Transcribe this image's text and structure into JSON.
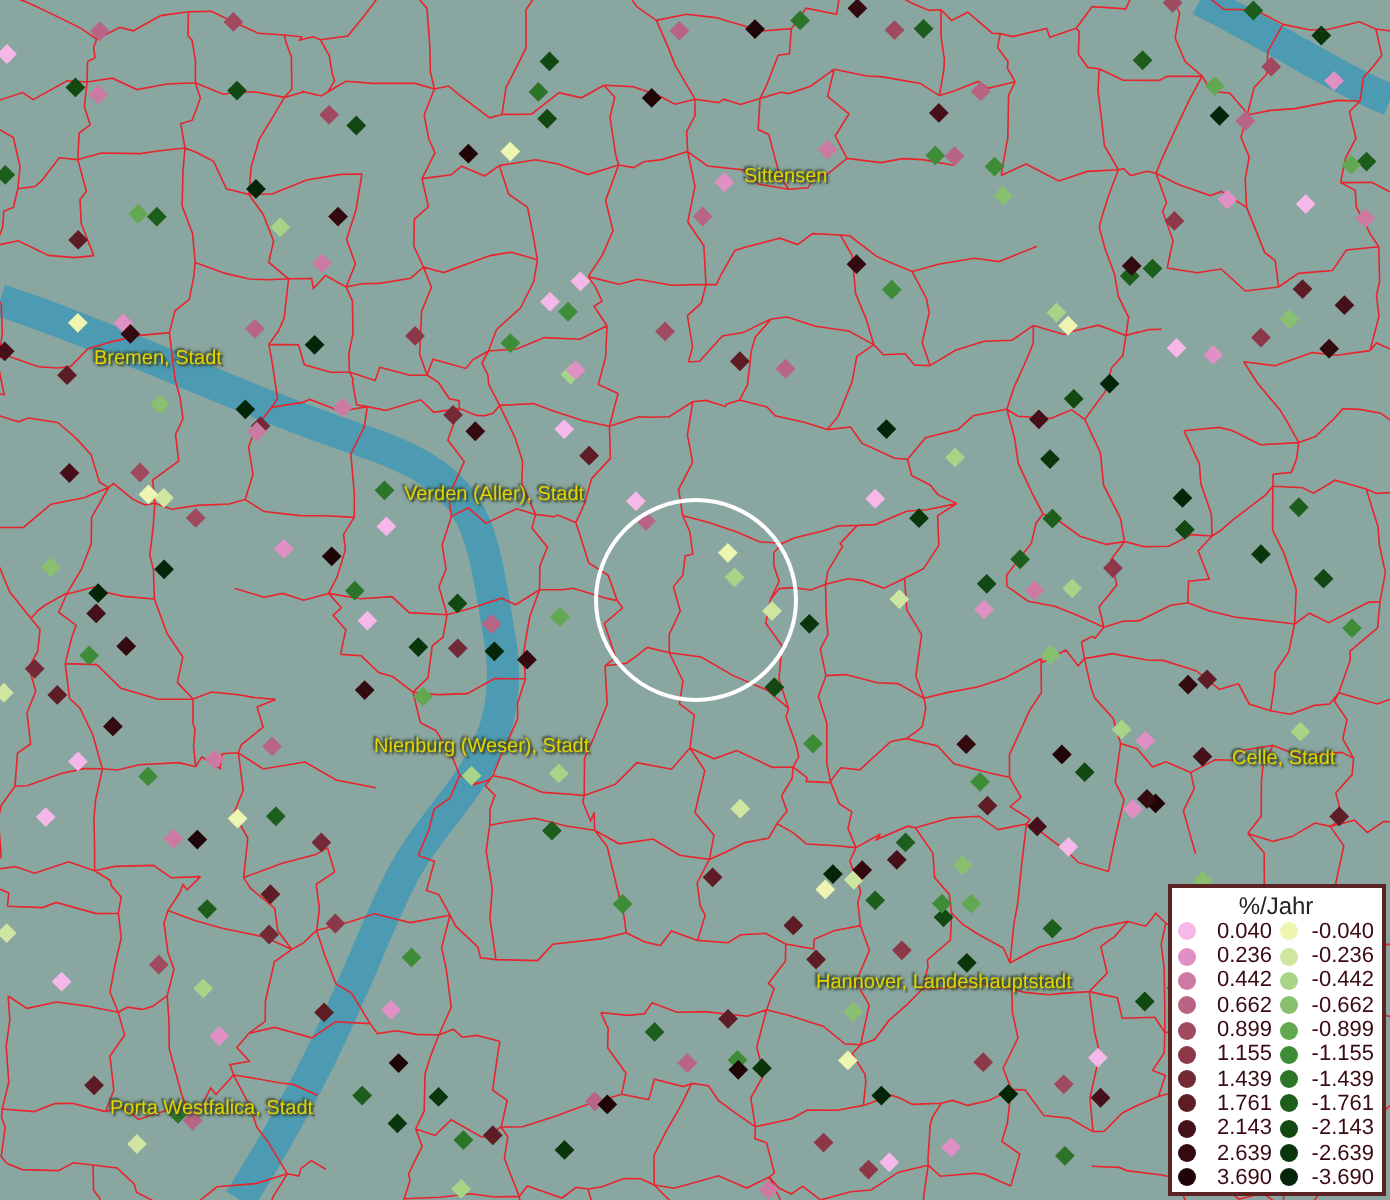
{
  "map": {
    "places": [
      {
        "name": "Sittensen"
      },
      {
        "name": "Bremen, Stadt"
      },
      {
        "name": "Verden (Aller), Stadt"
      },
      {
        "name": "Nienburg (Weser), Stadt"
      },
      {
        "name": "Celle, Stadt"
      },
      {
        "name": "Hannover, Landeshauptstadt"
      },
      {
        "name": "Porta Westfalica, Stadt"
      }
    ]
  },
  "legend": {
    "title": "%/Jahr",
    "positive": [
      {
        "label": "0.040",
        "color": "#f5b8e8"
      },
      {
        "label": "0.236",
        "color": "#e090c4"
      },
      {
        "label": "0.442",
        "color": "#cc7aa2"
      },
      {
        "label": "0.662",
        "color": "#b86484"
      },
      {
        "label": "0.899",
        "color": "#a04a60"
      },
      {
        "label": "1.155",
        "color": "#8c3848"
      },
      {
        "label": "1.439",
        "color": "#742a36"
      },
      {
        "label": "1.761",
        "color": "#5e1c24"
      },
      {
        "label": "2.143",
        "color": "#46101a"
      },
      {
        "label": "2.639",
        "color": "#320a10"
      },
      {
        "label": "3.690",
        "color": "#200508"
      }
    ],
    "negative": [
      {
        "label": "-0.040",
        "color": "#eef5b0"
      },
      {
        "label": "-0.236",
        "color": "#cfe6a0"
      },
      {
        "label": "-0.442",
        "color": "#a8d488"
      },
      {
        "label": "-0.662",
        "color": "#88c070"
      },
      {
        "label": "-0.899",
        "color": "#62a850"
      },
      {
        "label": "-1.155",
        "color": "#3f8c38"
      },
      {
        "label": "-1.439",
        "color": "#2c7428"
      },
      {
        "label": "-1.761",
        "color": "#1e5e1c"
      },
      {
        "label": "-2.143",
        "color": "#124812"
      },
      {
        "label": "-2.639",
        "color": "#0a360c"
      },
      {
        "label": "-3.690",
        "color": "#052508"
      }
    ]
  }
}
